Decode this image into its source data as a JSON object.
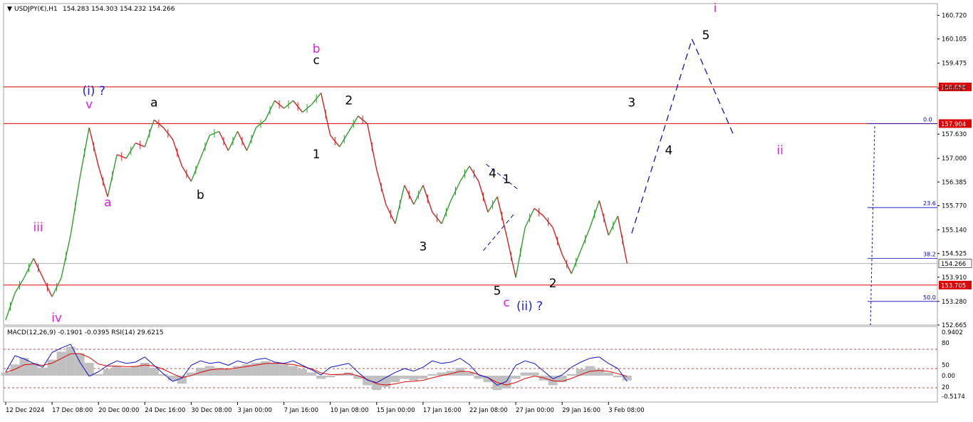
{
  "header": {
    "symbol": "USDJPY(€),H1",
    "ohlc": "154.283 154.303 154.232 154.266"
  },
  "sub_header": {
    "indicators": "MACD(12,26,9) -0.1901 -0.0395  RSI(14) 29.6215"
  },
  "chart_data": {
    "type": "line",
    "title": "USDJPY(€),H1",
    "price_axis": {
      "ylim": [
        152.665,
        161.025
      ],
      "ticks": [
        160.72,
        160.105,
        159.475,
        158.825,
        157.63,
        157.0,
        156.385,
        155.77,
        155.14,
        154.525,
        153.91,
        153.28,
        152.665
      ]
    },
    "time_axis": {
      "xlim": [
        0,
        72
      ],
      "labels": [
        {
          "x": 0,
          "text": "12 Dec 2024"
        },
        {
          "x": 5,
          "text": "17 Dec 08:00"
        },
        {
          "x": 10,
          "text": "20 Dec 00:00"
        },
        {
          "x": 15,
          "text": "24 Dec 16:00"
        },
        {
          "x": 20,
          "text": "30 Dec 08:00"
        },
        {
          "x": 25,
          "text": "3 Jan 00:00"
        },
        {
          "x": 30,
          "text": "7 Jan 16:00"
        },
        {
          "x": 35,
          "text": "10 Jan 08:00"
        },
        {
          "x": 40,
          "text": "15 Jan 00:00"
        },
        {
          "x": 45,
          "text": "17 Jan 16:00"
        },
        {
          "x": 50,
          "text": "22 Jan 08:00"
        },
        {
          "x": 55,
          "text": "27 Jan 00:00"
        },
        {
          "x": 60,
          "text": "29 Jan 16:00"
        },
        {
          "x": 65,
          "text": "3 Feb 08:00"
        }
      ]
    },
    "price_path": [
      [
        0,
        152.8
      ],
      [
        1,
        153.5
      ],
      [
        2,
        153.9
      ],
      [
        3,
        154.4
      ],
      [
        4,
        153.9
      ],
      [
        5,
        153.4
      ],
      [
        6,
        153.9
      ],
      [
        7,
        155.0
      ],
      [
        8,
        156.5
      ],
      [
        9,
        157.8
      ],
      [
        10,
        156.8
      ],
      [
        11,
        156.0
      ],
      [
        12,
        157.1
      ],
      [
        13,
        157.0
      ],
      [
        14,
        157.4
      ],
      [
        15,
        157.3
      ],
      [
        16,
        158.0
      ],
      [
        17,
        157.8
      ],
      [
        18,
        157.5
      ],
      [
        19,
        156.8
      ],
      [
        20,
        156.4
      ],
      [
        21,
        157.0
      ],
      [
        22,
        157.6
      ],
      [
        23,
        157.7
      ],
      [
        24,
        157.2
      ],
      [
        25,
        157.7
      ],
      [
        26,
        157.2
      ],
      [
        27,
        157.8
      ],
      [
        28,
        158.0
      ],
      [
        29,
        158.5
      ],
      [
        30,
        158.3
      ],
      [
        31,
        158.5
      ],
      [
        32,
        158.2
      ],
      [
        33,
        158.4
      ],
      [
        34,
        158.7
      ],
      [
        35,
        157.6
      ],
      [
        36,
        157.3
      ],
      [
        37,
        157.7
      ],
      [
        38,
        158.1
      ],
      [
        39,
        157.9
      ],
      [
        40,
        156.7
      ],
      [
        41,
        155.8
      ],
      [
        42,
        155.3
      ],
      [
        43,
        156.3
      ],
      [
        44,
        155.8
      ],
      [
        45,
        156.3
      ],
      [
        46,
        155.6
      ],
      [
        47,
        155.3
      ],
      [
        48,
        155.9
      ],
      [
        49,
        156.4
      ],
      [
        50,
        156.8
      ],
      [
        51,
        156.4
      ],
      [
        52,
        155.6
      ],
      [
        53,
        156.0
      ],
      [
        54,
        155.0
      ],
      [
        55,
        153.9
      ],
      [
        56,
        155.2
      ],
      [
        57,
        155.7
      ],
      [
        58,
        155.5
      ],
      [
        59,
        155.2
      ],
      [
        60,
        154.5
      ],
      [
        61,
        154.0
      ],
      [
        62,
        154.6
      ],
      [
        63,
        155.2
      ],
      [
        64,
        155.9
      ],
      [
        65,
        155.0
      ],
      [
        66,
        155.5
      ],
      [
        67,
        154.27
      ]
    ],
    "horizontal_levels": [
      {
        "price": 158.858,
        "label": "158.858",
        "color": "#e00000"
      },
      {
        "price": 157.904,
        "label": "157.904",
        "color": "#e00000"
      },
      {
        "price": 153.705,
        "label": "153.705",
        "color": "#e00000"
      },
      {
        "price": 154.266,
        "label": "154.266",
        "color": "#b0b0b0",
        "current": true
      }
    ],
    "fibonacci": [
      {
        "level": "0.0",
        "price": 157.904
      },
      {
        "level": "23.6",
        "price": 155.72
      },
      {
        "level": "38.2",
        "price": 154.4
      },
      {
        "level": "50.0",
        "price": 153.28
      }
    ],
    "projection": {
      "color": "#0000cc",
      "points": [
        [
          67.5,
          155.05
        ],
        [
          74,
          160.1
        ],
        [
          78.5,
          157.6
        ]
      ]
    },
    "wave_labels": [
      {
        "text": "iii",
        "x": 3.5,
        "price": 155.1,
        "color": "#e01ee0"
      },
      {
        "text": "iv",
        "x": 5.5,
        "price": 152.75,
        "color": "#e01ee0"
      },
      {
        "text": "(i) ?",
        "x": 9.5,
        "price": 158.65,
        "color": "#2020e0"
      },
      {
        "text": "v",
        "x": 9,
        "price": 158.3,
        "color": "#e01ee0"
      },
      {
        "text": "a",
        "x": 11,
        "price": 155.75,
        "color": "#e01ee0"
      },
      {
        "text": "a",
        "x": 16,
        "price": 158.35,
        "color": "#000000"
      },
      {
        "text": "b",
        "x": 21,
        "price": 155.95,
        "color": "#000000"
      },
      {
        "text": "b",
        "x": 33.5,
        "price": 159.75,
        "color": "#e01ee0"
      },
      {
        "text": "c",
        "x": 33.5,
        "price": 159.45,
        "color": "#000000"
      },
      {
        "text": "1",
        "x": 33.5,
        "price": 157.0,
        "color": "#000000"
      },
      {
        "text": "2",
        "x": 37,
        "price": 158.4,
        "color": "#000000"
      },
      {
        "text": "3",
        "x": 45,
        "price": 154.6,
        "color": "#000000"
      },
      {
        "text": "4",
        "x": 52.5,
        "price": 156.5,
        "color": "#000000"
      },
      {
        "text": "1",
        "x": 54,
        "price": 156.35,
        "color": "#000000"
      },
      {
        "text": "5",
        "x": 53,
        "price": 153.45,
        "color": "#000000"
      },
      {
        "text": "c",
        "x": 54,
        "price": 153.15,
        "color": "#e01ee0"
      },
      {
        "text": "(ii) ?",
        "x": 56.5,
        "price": 153.05,
        "color": "#2020e0"
      },
      {
        "text": "2",
        "x": 59,
        "price": 153.65,
        "color": "#000000"
      },
      {
        "text": "3",
        "x": 67.5,
        "price": 158.35,
        "color": "#000000"
      },
      {
        "text": "4",
        "x": 71.5,
        "price": 157.1,
        "color": "#000000"
      },
      {
        "text": "5",
        "x": 75.5,
        "price": 160.1,
        "color": "#000000"
      },
      {
        "text": "i",
        "x": 76.5,
        "price": 160.8,
        "color": "#e01ee0"
      },
      {
        "text": "ii",
        "x": 83.5,
        "price": 157.1,
        "color": "#e01ee0"
      }
    ],
    "indicator_panel": {
      "right_ticks": [
        "0.9402",
        "80",
        "50",
        "0.00",
        "20",
        "-0.5174"
      ],
      "macd_hist": [
        0.1,
        0.35,
        0.55,
        0.4,
        0.25,
        0.5,
        0.75,
        0.9,
        0.7,
        0.4,
        0.05,
        0.2,
        0.3,
        0.25,
        0.3,
        0.4,
        0.25,
        0.05,
        -0.15,
        -0.25,
        0.1,
        0.25,
        0.3,
        0.25,
        0.2,
        0.3,
        0.35,
        0.4,
        0.45,
        0.4,
        0.35,
        0.3,
        0.2,
        0.1,
        -0.1,
        -0.05,
        0.05,
        0.1,
        -0.1,
        -0.3,
        -0.45,
        -0.35,
        -0.2,
        -0.1,
        -0.15,
        -0.1,
        0.05,
        0.1,
        0.15,
        0.25,
        0.1,
        -0.1,
        -0.2,
        -0.45,
        -0.4,
        -0.1,
        0.1,
        0.1,
        -0.15,
        -0.3,
        -0.2,
        0.05,
        0.2,
        0.3,
        0.2,
        0.1,
        -0.05,
        -0.15
      ],
      "rsi": [
        45,
        70,
        65,
        58,
        52,
        75,
        82,
        88,
        60,
        38,
        45,
        55,
        62,
        58,
        60,
        68,
        55,
        42,
        30,
        35,
        55,
        62,
        58,
        60,
        55,
        62,
        58,
        64,
        66,
        60,
        58,
        62,
        55,
        48,
        40,
        52,
        55,
        58,
        44,
        32,
        28,
        36,
        44,
        50,
        46,
        52,
        62,
        58,
        60,
        66,
        56,
        40,
        36,
        24,
        30,
        55,
        62,
        58,
        46,
        34,
        40,
        52,
        60,
        66,
        68,
        58,
        50,
        30
      ]
    }
  }
}
